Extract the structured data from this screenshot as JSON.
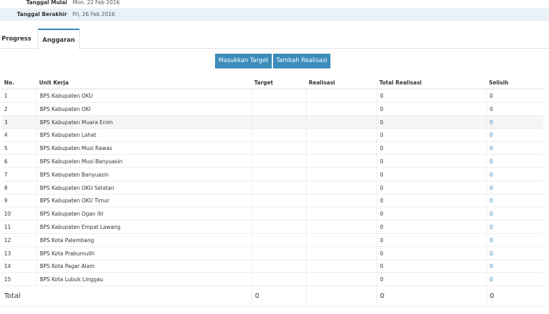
{
  "info": {
    "start_label": "Tanggal Mulai",
    "start_value": "Mon, 22 Feb 2016",
    "end_label": "Tanggal Berakhir",
    "end_value": "Fri, 26 Feb 2016"
  },
  "tabs": [
    {
      "label": "Progress"
    },
    {
      "label": "Anggaran"
    }
  ],
  "buttons": {
    "target": "Masukkan Target",
    "realisasi": "Tambah Realisasi"
  },
  "table": {
    "headers": {
      "no": "No.",
      "unit": "Unit Kerja",
      "target": "Target",
      "realisasi": "Realisasi",
      "total": "Total Realisasi",
      "selisih": "Selisih"
    },
    "rows": [
      {
        "no": "1",
        "unit": "BPS Kabupaten OKU",
        "target": "",
        "realisasi": "",
        "total": "0",
        "selisih": "0"
      },
      {
        "no": "2",
        "unit": "BPS Kabupaten OKI",
        "target": "",
        "realisasi": "",
        "total": "0",
        "selisih": "0"
      },
      {
        "no": "3",
        "unit": "BPS Kabupaten Muara Enim",
        "target": "",
        "realisasi": "",
        "total": "0",
        "selisih": "0"
      },
      {
        "no": "4",
        "unit": "BPS Kabupaten Lahat",
        "target": "",
        "realisasi": "",
        "total": "0",
        "selisih": "0"
      },
      {
        "no": "5",
        "unit": "BPS Kabupaten Musi Rawas",
        "target": "",
        "realisasi": "",
        "total": "0",
        "selisih": "0"
      },
      {
        "no": "6",
        "unit": "BPS Kabupaten Musi Banyuasin",
        "target": "",
        "realisasi": "",
        "total": "0",
        "selisih": "0"
      },
      {
        "no": "7",
        "unit": "BPS Kabupaten Banyuasin",
        "target": "",
        "realisasi": "",
        "total": "0",
        "selisih": "0"
      },
      {
        "no": "8",
        "unit": "BPS Kabupaten OKU Selatan",
        "target": "",
        "realisasi": "",
        "total": "0",
        "selisih": "0"
      },
      {
        "no": "9",
        "unit": "BPS Kabupaten OKU Timur",
        "target": "",
        "realisasi": "",
        "total": "0",
        "selisih": "0"
      },
      {
        "no": "10",
        "unit": "BPS Kabupaten Ogan Ilir",
        "target": "",
        "realisasi": "",
        "total": "0",
        "selisih": "0"
      },
      {
        "no": "11",
        "unit": "BPS Kabupaten Empat Lawang",
        "target": "",
        "realisasi": "",
        "total": "0",
        "selisih": "0"
      },
      {
        "no": "12",
        "unit": "BPS Kota Palembang",
        "target": "",
        "realisasi": "",
        "total": "0",
        "selisih": "0"
      },
      {
        "no": "13",
        "unit": "BPS Kota Prabumulih",
        "target": "",
        "realisasi": "",
        "total": "0",
        "selisih": "0"
      },
      {
        "no": "14",
        "unit": "BPS Kota Pagar Alam",
        "target": "",
        "realisasi": "",
        "total": "0",
        "selisih": "0"
      },
      {
        "no": "15",
        "unit": "BPS Kota Lubuk Linggau",
        "target": "",
        "realisasi": "",
        "total": "0",
        "selisih": "0"
      }
    ],
    "total": {
      "label": "Total",
      "target": "0",
      "total": "0",
      "selisih": "0"
    }
  },
  "colors": {
    "accent": "#3c8dbc",
    "info_bg": "#e8f1f8"
  }
}
